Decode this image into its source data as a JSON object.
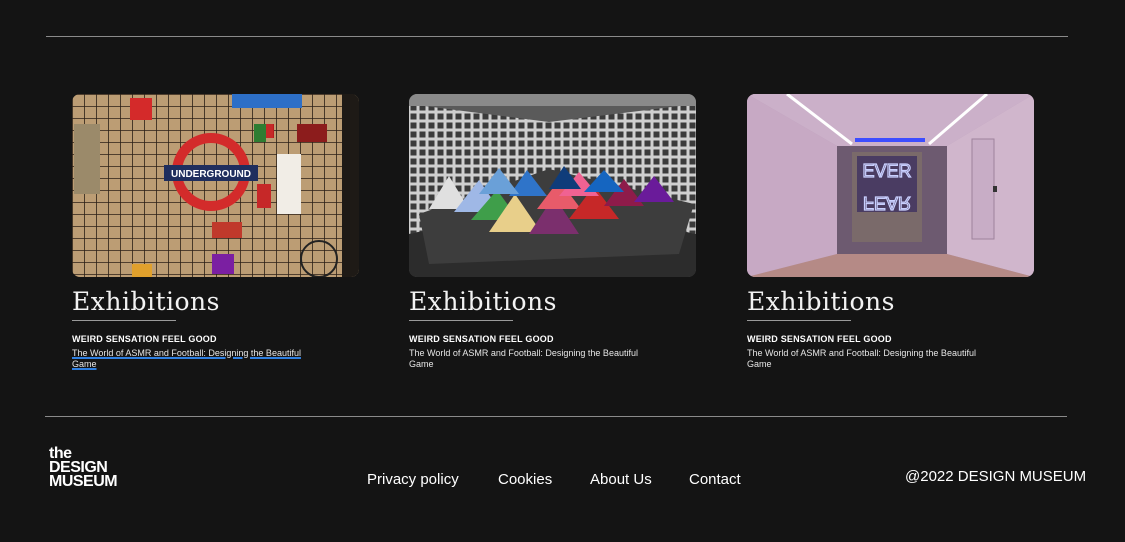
{
  "cards": [
    {
      "image_alt": "underground",
      "category": "Exhibitions",
      "title": "WEIRD SENSATION FEEL GOOD",
      "description": "The World of ASMR and Football: Designing the Beautiful Game"
    },
    {
      "image_alt": "",
      "category": "Exhibitions",
      "title": "WEIRD SENSATION FEEL GOOD",
      "description": "The World of ASMR and Football: Designing the Beautiful Game"
    },
    {
      "image_alt": "",
      "category": "Exhibitions",
      "title": "WEIRD SENSATION FEEL GOOD",
      "description": "The World of ASMR and Football: Designing the Beautiful Game"
    }
  ],
  "underground_sign": "UNDERGROUND",
  "neon_sign": {
    "line1": "EVER",
    "line2": "FEAR"
  },
  "footer": {
    "logo": {
      "line1": "the",
      "line2": "DESIGN",
      "line3": "MUSEUM"
    },
    "links": [
      "Privacy policy",
      "Cookies",
      "About Us",
      "Contact"
    ],
    "copyright": "@2022 DESIGN MUSEUM"
  },
  "colors": {
    "background": "#141414",
    "link_underline": "#2f7fe0",
    "text": "#ffffff"
  }
}
